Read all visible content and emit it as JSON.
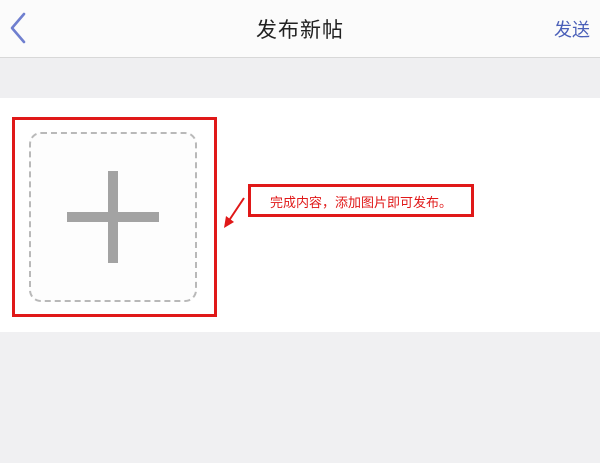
{
  "header": {
    "back_icon": "chevron-left-icon",
    "title": "发布新帖",
    "send_label": "发送"
  },
  "composer": {
    "add_image_icon": "plus-icon"
  },
  "annotation": {
    "text": "完成内容，添加图片即可发布。",
    "color": "#e01818"
  },
  "colors": {
    "accent": "#4a5fb8",
    "highlight": "#e01818"
  }
}
